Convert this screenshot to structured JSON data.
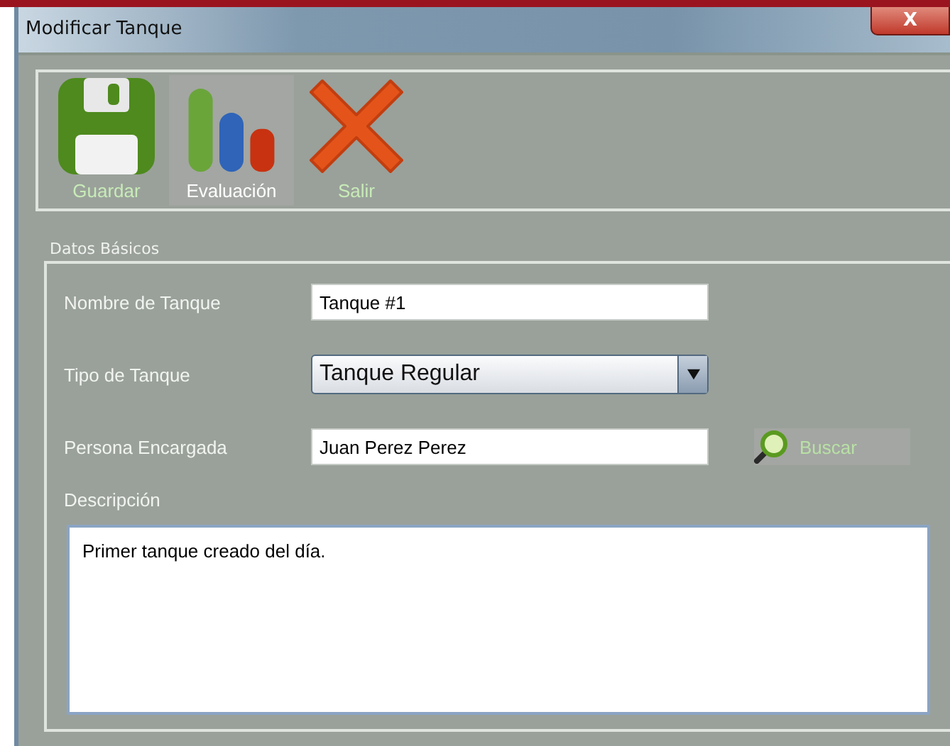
{
  "window": {
    "title": "Modificar Tanque",
    "close_label": "X"
  },
  "toolbar": [
    {
      "kind": "save",
      "label": "Guardar",
      "selected": false
    },
    {
      "kind": "chart",
      "label": "Evaluación",
      "selected": true
    },
    {
      "kind": "exit",
      "label": "Salir",
      "selected": false
    }
  ],
  "section": {
    "title": "Datos Básicos"
  },
  "fields": [
    {
      "kind": "text",
      "label": "Nombre de Tanque",
      "value": "Tanque #1"
    },
    {
      "kind": "select",
      "label": "Tipo de Tanque",
      "value": "Tanque Regular"
    },
    {
      "kind": "search",
      "label": "Persona Encargada",
      "value": "Juan Perez Perez",
      "button": "Buscar"
    }
  ],
  "description": {
    "label": "Descripción",
    "value": "Primer tanque creado del día."
  }
}
